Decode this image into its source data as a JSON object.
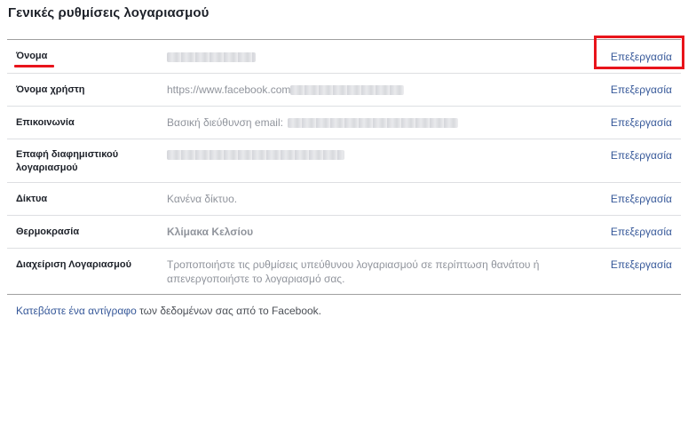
{
  "page_title": "Γενικές ρυθμίσεις λογαριασμού",
  "edit_label": "Επεξεργασία",
  "accent_color": "#e8141b",
  "link_color": "#365899",
  "rows": [
    {
      "label": "Όνομα",
      "value": ""
    },
    {
      "label": "Όνομα χρήστη",
      "value": "https://www.facebook.com"
    },
    {
      "label": "Επικοινωνία",
      "value": "Βασική διεύθυνση email:"
    },
    {
      "label": "Επαφή διαφημιστικού λογαριασμού",
      "value": ""
    },
    {
      "label": "Δίκτυα",
      "value": "Κανένα δίκτυο."
    },
    {
      "label": "Θερμοκρασία",
      "value": "Κλίμακα Κελσίου"
    },
    {
      "label": "Διαχείριση Λογαριασμού",
      "value": "Τροποποιήστε τις ρυθμίσεις υπεύθυνου λογαριασμού σε περίπτωση θανάτου ή απενεργοποιήστε το λογαριασμό σας."
    }
  ],
  "footer": {
    "link_text": "Κατεβάστε ένα αντίγραφο",
    "rest_text": " των δεδομένων σας από το Facebook."
  }
}
